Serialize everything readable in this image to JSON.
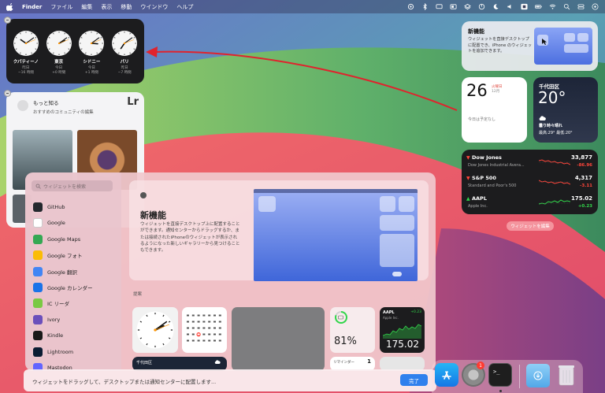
{
  "menubar": {
    "app_name": "Finder",
    "items": [
      "ファイル",
      "編集",
      "表示",
      "移動",
      "ウインドウ",
      "ヘルプ"
    ]
  },
  "world_clock": {
    "cities": [
      {
        "name": "クパティーノ",
        "day": "昨日",
        "offset": "−16 時間",
        "hour": 10,
        "minute": 9
      },
      {
        "name": "東京",
        "day": "今日",
        "offset": "+0 時間",
        "hour": 2,
        "minute": 9
      },
      {
        "name": "シドニー",
        "day": "今日",
        "offset": "+1 時間",
        "hour": 3,
        "minute": 9
      },
      {
        "name": "パリ",
        "day": "昨日",
        "offset": "−7 時間",
        "hour": 7,
        "minute": 9
      }
    ]
  },
  "lightroom": {
    "title": "もっと知る",
    "subtitle": "おすすめのコミュニティの編集",
    "logo": "Lr"
  },
  "new_features": {
    "title": "新機能",
    "text": "ウィジェットを直接デスクトップに配置でき、iPhone のウィジェットを追加できます。"
  },
  "calendar": {
    "day_number": "26",
    "weekday": "火曜日",
    "month": "12月",
    "note": "今日は予定なし"
  },
  "weather": {
    "city": "千代田区",
    "temp": "20°",
    "condition": "曇り時々晴れ",
    "high_low": "最高:29° 最低:20°"
  },
  "stocks": [
    {
      "symbol": "Dow Jones",
      "name": "Dow Jones Industrial Avera...",
      "value": "33,877",
      "change": "-86.96",
      "up": false
    },
    {
      "symbol": "S&P 500",
      "name": "Standard and Poor's 500",
      "value": "4,317",
      "change": "-3.11",
      "up": false
    },
    {
      "symbol": "AAPL",
      "name": "Apple Inc.",
      "value": "175.02",
      "change": "+0.23",
      "up": true
    }
  ],
  "edit_widgets_label": "ウィジェットを編集",
  "gallery": {
    "search_placeholder": "ウィジェットを検索",
    "apps": [
      {
        "name": "GitHub",
        "icon": "github-icon",
        "color": "#24292e"
      },
      {
        "name": "Google",
        "icon": "google-icon",
        "color": "#ffffff"
      },
      {
        "name": "Google Maps",
        "icon": "maps-icon",
        "color": "#34a853"
      },
      {
        "name": "Google フォト",
        "icon": "photos-icon",
        "color": "#fbbc05"
      },
      {
        "name": "Google 翻訳",
        "icon": "translate-icon",
        "color": "#4285f4"
      },
      {
        "name": "Google カレンダー",
        "icon": "calendar-icon",
        "color": "#1a73e8"
      },
      {
        "name": "IC リーダ",
        "icon": "ic-reader-icon",
        "color": "#7ac943"
      },
      {
        "name": "Ivory",
        "icon": "ivory-icon",
        "color": "#6b4fbb"
      },
      {
        "name": "Kindle",
        "icon": "kindle-icon",
        "color": "#1a1a1a"
      },
      {
        "name": "Lightroom",
        "icon": "lightroom-icon",
        "color": "#0b1d33"
      },
      {
        "name": "Mastodon",
        "icon": "mastodon-icon",
        "color": "#6364ff"
      }
    ],
    "hero_title": "新機能",
    "hero_text": "ウィジェットを直接デスクトップ上に配置することができます。通知センターからドラッグするか、または接続されたiPhoneのウィジェットが表示されるようになった新しいギャラリーから見つけることもできます。",
    "section_label": "提案",
    "battery_percent": "81%",
    "battery_level": 0.81,
    "stock_symbol": "AAPL",
    "stock_name": "Apple Inc.",
    "stock_change": "+0.23",
    "stock_value": "175.02",
    "reminder_label": "リマインダー",
    "reminder_count": "1",
    "weather_city": "千代田区"
  },
  "banner": {
    "text": "ウィジェットをドラッグして、デスクトップまたは通知センターに配置します...",
    "done_label": "完了"
  },
  "dock": {
    "settings_badge": "1"
  }
}
